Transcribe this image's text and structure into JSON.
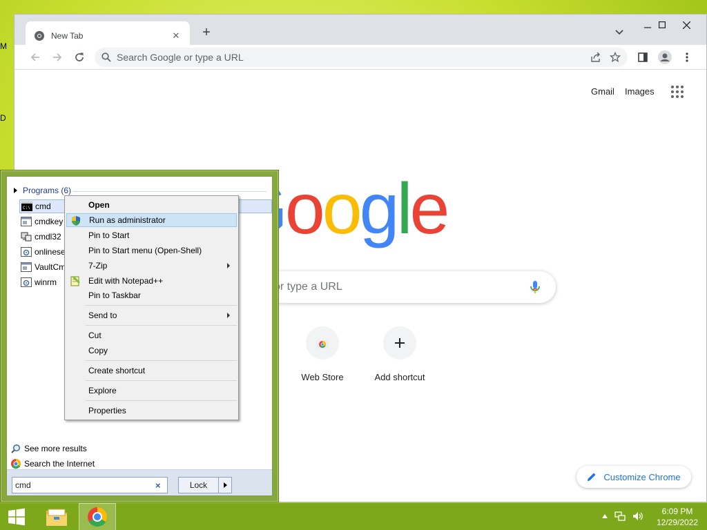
{
  "desktop": {
    "edge_letters": [
      "M",
      "D"
    ]
  },
  "browser": {
    "tab_title": "New Tab",
    "omnibox_placeholder": "Search Google or type a URL",
    "ntp": {
      "top_links": [
        "Gmail",
        "Images"
      ],
      "logo_letters": [
        "G",
        "o",
        "o",
        "g",
        "l",
        "e"
      ],
      "logo_colors": [
        "#4285f4",
        "#ea4335",
        "#fbbc05",
        "#4285f4",
        "#34a853",
        "#ea4335"
      ],
      "search_placeholder_visible": "or type a URL",
      "shortcuts": [
        {
          "label": "Web Store",
          "icon": "web-store-icon"
        },
        {
          "label": "Add shortcut",
          "icon": "plus-icon"
        }
      ],
      "customize_label": "Customize Chrome"
    }
  },
  "start_menu": {
    "group_header": "Programs (6)",
    "programs": [
      {
        "label": "cmd",
        "icon": "console-icon",
        "selected": true
      },
      {
        "label": "cmdkey",
        "icon": "window-icon",
        "selected": false
      },
      {
        "label": "cmdl32",
        "icon": "network-icon",
        "selected": false
      },
      {
        "label": "onlinese",
        "icon": "gear-window-icon",
        "selected": false
      },
      {
        "label": "VaultCm",
        "icon": "window-icon",
        "selected": false
      },
      {
        "label": "winrm",
        "icon": "gear-window-icon",
        "selected": false
      }
    ],
    "see_more": "See more results",
    "search_internet": "Search the Internet",
    "search_value": "cmd",
    "clear_glyph": "×",
    "power_button_label": "Lock"
  },
  "context_menu": {
    "items": [
      {
        "label": "Open",
        "bold": true
      },
      {
        "label": "Run as administrator",
        "highlighted": true,
        "icon": "uac-shield-icon"
      },
      {
        "label": "Pin to Start"
      },
      {
        "label": "Pin to Start menu (Open-Shell)"
      },
      {
        "label": "7-Zip",
        "submenu": true
      },
      {
        "label": "Edit with Notepad++",
        "icon": "notepad-plus-plus-icon"
      },
      {
        "label": "Pin to Taskbar"
      },
      {
        "label": "Send to",
        "submenu": true
      },
      {
        "label": "Cut"
      },
      {
        "label": "Copy"
      },
      {
        "label": "Create shortcut"
      },
      {
        "label": "Explore"
      },
      {
        "label": "Properties"
      }
    ]
  },
  "taskbar": {
    "time": "6:09 PM",
    "date": "12/29/2022",
    "pinned": [
      "windows-start-icon",
      "file-explorer-icon",
      "chrome-icon"
    ],
    "tray_icons": [
      "chevron-up-icon",
      "network-icon",
      "volume-icon"
    ]
  },
  "colors": {
    "desktop_green": "#9fc21a",
    "taskbar_green": "#7ea81b",
    "link_blue": "#1a73e8",
    "menu_highlight": "#cde4f7"
  }
}
